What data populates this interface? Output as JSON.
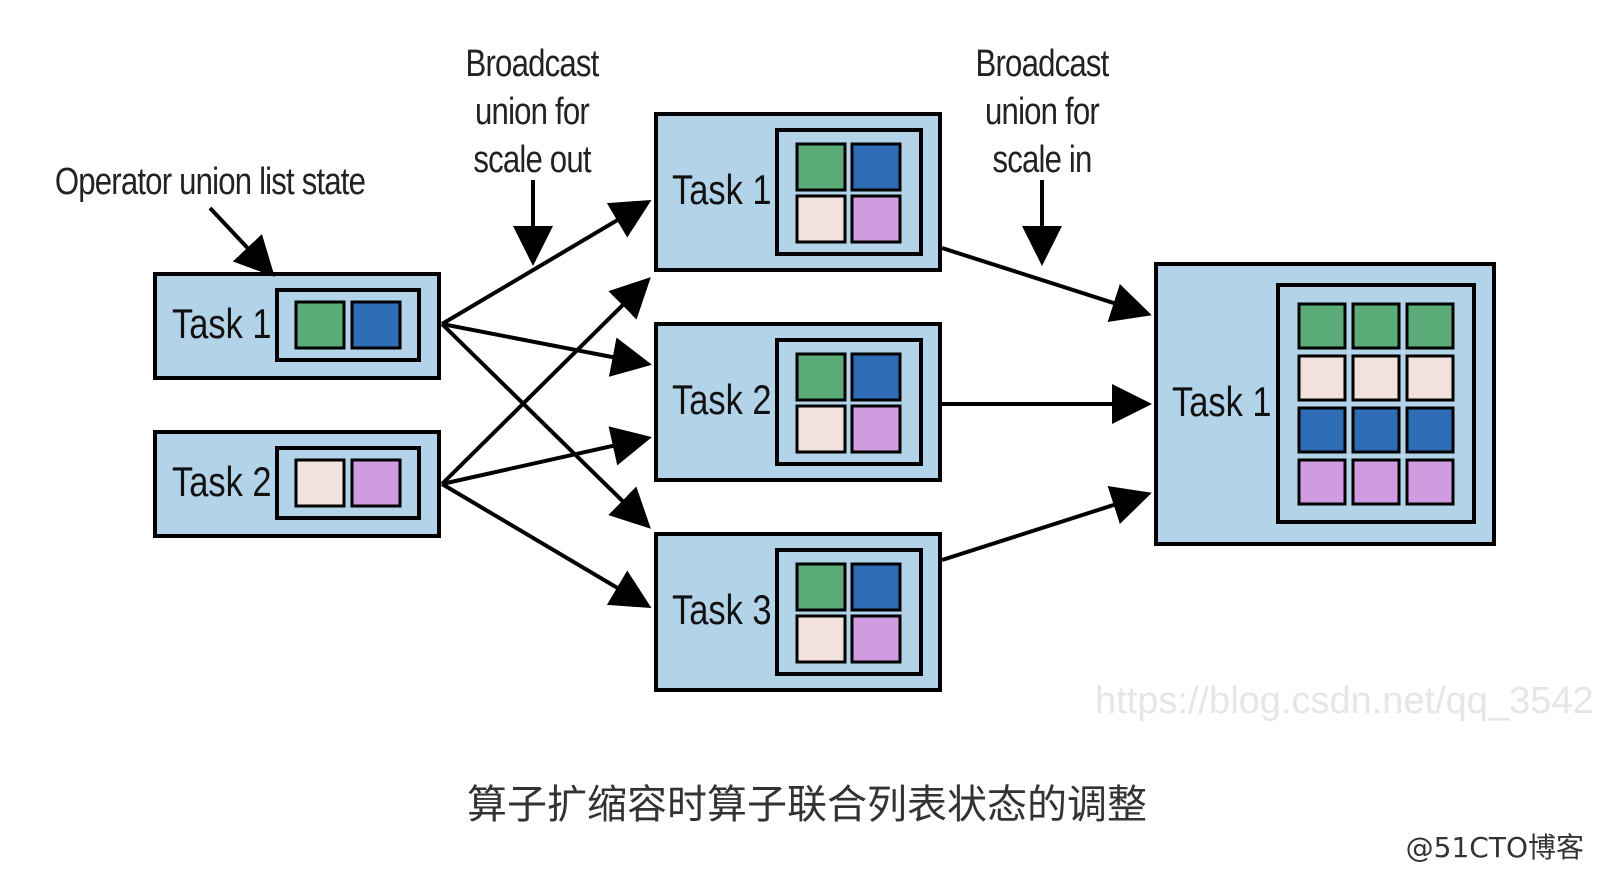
{
  "labels": {
    "operator_state": "Operator union list state",
    "scale_out": [
      "Broadcast",
      "union for",
      "scale out"
    ],
    "scale_in": [
      "Broadcast",
      "union for",
      "scale in"
    ]
  },
  "tasks": {
    "left_task1": "Task 1",
    "left_task2": "Task 2",
    "mid_task1": "Task 1",
    "mid_task2": "Task 2",
    "mid_task3": "Task 3",
    "right_task1": "Task 1"
  },
  "caption": "算子扩缩容时算子联合列表状态的调整",
  "watermark": "https://blog.csdn.net/qq_3542",
  "footer": "@51CTO博客",
  "colors": {
    "box_fill": "#b3d3e8",
    "green": "#5aab78",
    "blue": "#2e6db5",
    "pink": "#f3e1dd",
    "purple": "#d09be0"
  }
}
